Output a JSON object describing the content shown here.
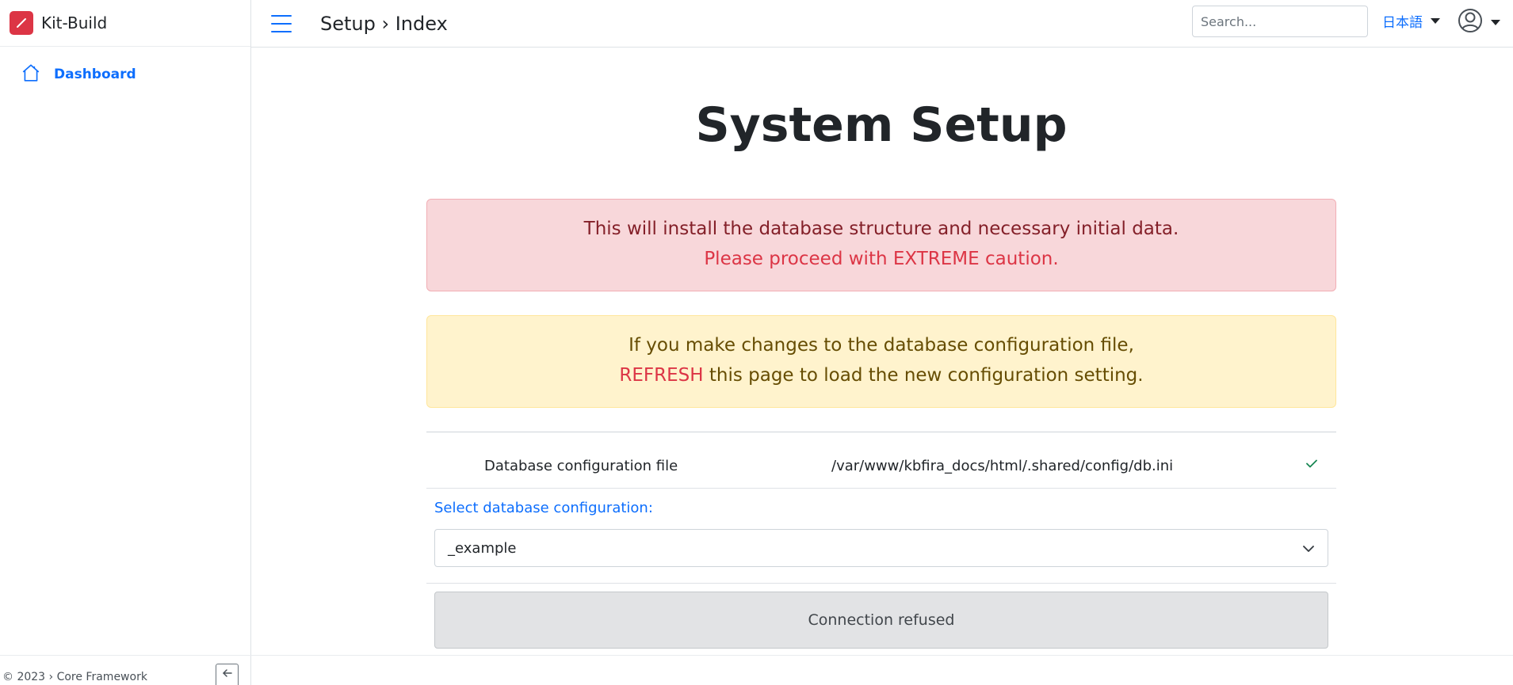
{
  "app": {
    "name": "Kit-Build",
    "brand_color": "#dc3545",
    "accent_color": "#0d6efd"
  },
  "sidebar": {
    "items": [
      {
        "label": "Dashboard",
        "icon": "home-icon"
      }
    ],
    "footer": "© 2023 › Core Framework",
    "collapse_icon": "arrow-left-icon"
  },
  "header": {
    "menu_icon": "hamburger-icon",
    "breadcrumb": "Setup › Index",
    "search_placeholder": "Search...",
    "search_value": "",
    "language": "日本語",
    "user_icon": "user-circle-icon"
  },
  "main": {
    "title": "System Setup",
    "danger_alert": {
      "line1": "This will install the database structure and necessary initial data.",
      "line2": "Please proceed with EXTREME caution."
    },
    "warning_alert": {
      "line1": "If you make changes to the database configuration file,",
      "refresh": "REFRESH",
      "line2_rest": " this page to load the new configuration setting."
    },
    "config_file": {
      "label": "Database configuration file",
      "path": "/var/www/kbfira_docs/html/.shared/config/db.ini",
      "status_icon": "check-icon"
    },
    "select_label": "Select database configuration:",
    "select_value": "_example",
    "connection_status": "Connection refused"
  }
}
